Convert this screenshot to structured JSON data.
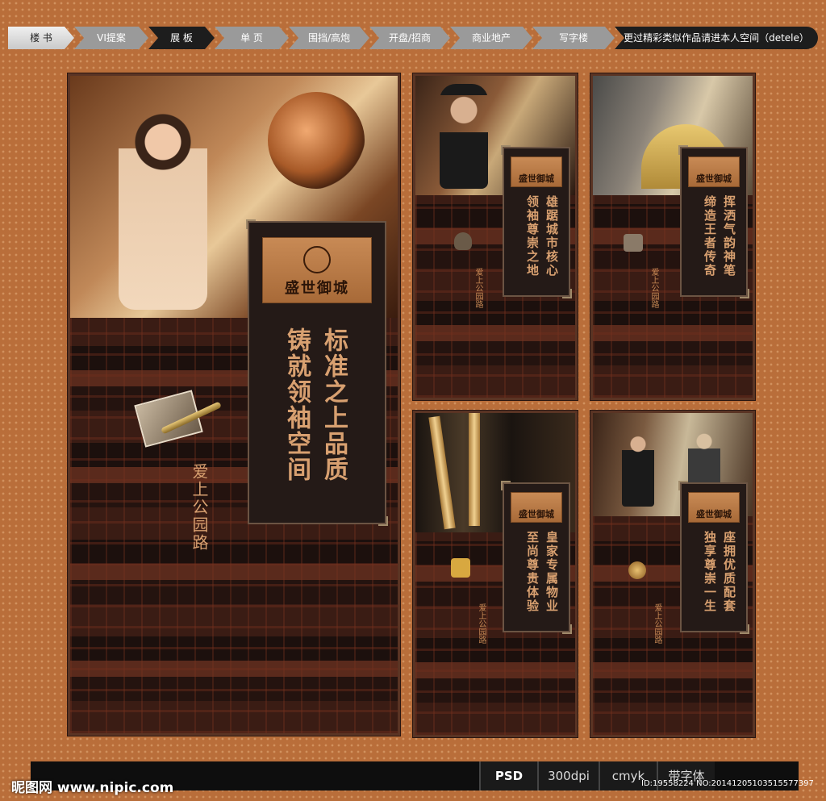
{
  "nav": {
    "items": [
      "楼 书",
      "VI提案",
      "展 板",
      "单 页",
      "围挡/高炮",
      "开盘/招商",
      "商业地产",
      "写字楼"
    ],
    "more": "更过精彩类似作品请进本人空间（detele）"
  },
  "main": {
    "logo": "盛世御城",
    "headline_col1": "标准之上品质",
    "headline_col2": "铸就领袖空间",
    "subtitle": "爱上公园路"
  },
  "panels": [
    {
      "logo": "盛世御城",
      "line1": "雄踞城市核心",
      "line2": "领袖尊崇之地",
      "sub": "爱上公园路"
    },
    {
      "logo": "盛世御城",
      "line1": "挥洒气韵神笔",
      "line2": "缔造王者传奇",
      "sub": "爱上公园路"
    },
    {
      "logo": "盛世御城",
      "line1": "皇家专属物业",
      "line2": "至尚尊贵体验",
      "sub": "爱上公园路"
    },
    {
      "logo": "盛世御城",
      "line1": "座拥优质配套",
      "line2": "独享尊崇一生",
      "sub": "爱上公园路"
    }
  ],
  "footer": {
    "format": "PSD",
    "dpi": "300dpi",
    "color_mode": "cmyk",
    "note": "带字体",
    "site": "昵图网 www.nipic.com",
    "id": "ID:19558224 NO:20141205103515577397"
  }
}
